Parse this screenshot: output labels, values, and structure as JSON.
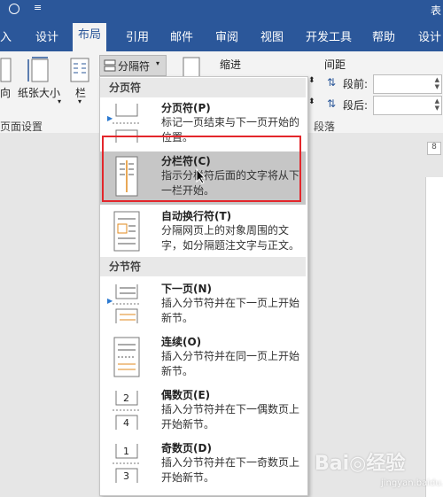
{
  "titlebar": {
    "menu_glyph": "≡",
    "title": "表"
  },
  "tabs": [
    "入",
    "设计",
    "布局",
    "引用",
    "邮件",
    "审阅",
    "视图",
    "开发工具",
    "帮助",
    "设计"
  ],
  "ribbon": {
    "direction_label": "向",
    "paper_size_label": "纸张大小",
    "columns_label": "栏",
    "breaks_label": "分隔符",
    "indent_label": "缩进",
    "spacing_label": "间距",
    "before_label": "段前:",
    "after_label": "段后:",
    "page_setup_group": "页面设置",
    "paragraph_group": "段落",
    "ruler_value": "8"
  },
  "dropdown": {
    "page_breaks_header": "分页符",
    "section_breaks_header": "分节符",
    "items": [
      {
        "title": "分页符(P)",
        "desc": "标记一页结束与下一页开始的位置。"
      },
      {
        "title": "分栏符(C)",
        "desc": "指示分栏符后面的文字将从下一栏开始。"
      },
      {
        "title": "自动换行符(T)",
        "desc": "分隔网页上的对象周围的文字，如分隔题注文字与正文。"
      },
      {
        "title": "下一页(N)",
        "desc": "插入分节符并在下一页上开始新节。"
      },
      {
        "title": "连续(O)",
        "desc": "插入分节符并在同一页上开始新节。"
      },
      {
        "title": "偶数页(E)",
        "desc": "插入分节符并在下一偶数页上开始新节。"
      },
      {
        "title": "奇数页(D)",
        "desc": "插入分节符并在下一奇数页上开始新节。"
      }
    ]
  },
  "watermark": {
    "logo": "Bai◎经验",
    "url": "jingyan.baidu.com"
  },
  "colors": {
    "ribbon_blue": "#2b579a",
    "highlight": "#c6c6c6",
    "annotation_red": "#e3262b"
  }
}
